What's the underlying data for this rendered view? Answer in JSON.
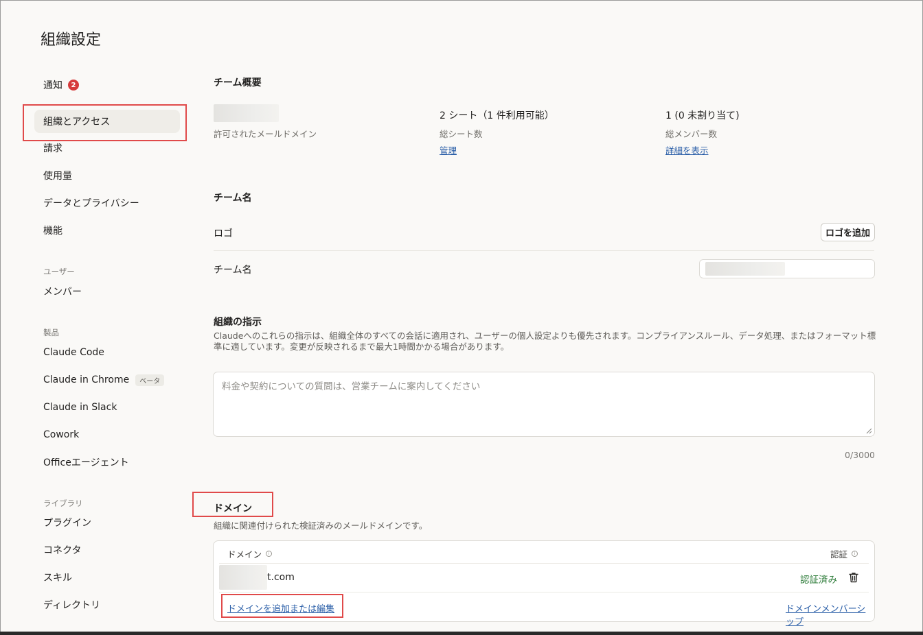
{
  "page_title": "組織設定",
  "sidebar": {
    "items_top": [
      {
        "label": "通知",
        "badge": "2"
      },
      {
        "label": "組織とアクセス"
      },
      {
        "label": "請求"
      },
      {
        "label": "使用量"
      },
      {
        "label": "データとプライバシー"
      },
      {
        "label": "機能"
      }
    ],
    "users_head": "ユーザー",
    "users_items": [
      {
        "label": "メンバー"
      }
    ],
    "products_head": "製品",
    "product_items": [
      {
        "label": "Claude Code"
      },
      {
        "label": "Claude in Chrome",
        "tag": "ベータ"
      },
      {
        "label": "Claude in Slack"
      },
      {
        "label": "Cowork"
      },
      {
        "label": "Officeエージェント"
      }
    ],
    "library_head": "ライブラリ",
    "library_items": [
      {
        "label": "プラグイン"
      },
      {
        "label": "コネクタ"
      },
      {
        "label": "スキル"
      },
      {
        "label": "ディレクトリ"
      }
    ]
  },
  "overview": {
    "title": "チーム概要",
    "allowed_domain_label": "許可されたメールドメイン",
    "seats_value": "2 シート（1 件利用可能）",
    "seats_label": "総シート数",
    "seats_link": "管理",
    "members_value": "1 (0 未割り当て)",
    "members_label": "総メンバー数",
    "members_link": "詳細を表示"
  },
  "team_name": {
    "title": "チーム名",
    "logo_label": "ロゴ",
    "add_logo_button": "ロゴを追加",
    "name_label": "チーム名"
  },
  "instructions": {
    "title": "組織の指示",
    "description": "Claudeへのこれらの指示は、組織全体のすべての会話に適用され、ユーザーの個人設定よりも優先されます。コンプライアンスルール、データ処理、またはフォーマット標準に適しています。変更が反映されるまで最大1時間かかる場合があります。",
    "placeholder": "料金や契約についての質問は、営業チームに案内してください",
    "counter": "0/3000"
  },
  "domains": {
    "title": "ドメイン",
    "description": "組織に関連付けられた検証済みのメールドメインです。",
    "col_domain": "ドメイン",
    "col_verification": "認証",
    "row_domain_visible": "t.com",
    "row_status": "認証済み",
    "add_edit_link": "ドメインを追加または編集",
    "domain_members_link": "ドメインメンバーシップ"
  },
  "colors": {
    "accent_link": "#2b5fa8",
    "verified_green": "#2f7d3b",
    "badge_red": "#d63b3b",
    "highlight_red": "#e04a4a"
  }
}
